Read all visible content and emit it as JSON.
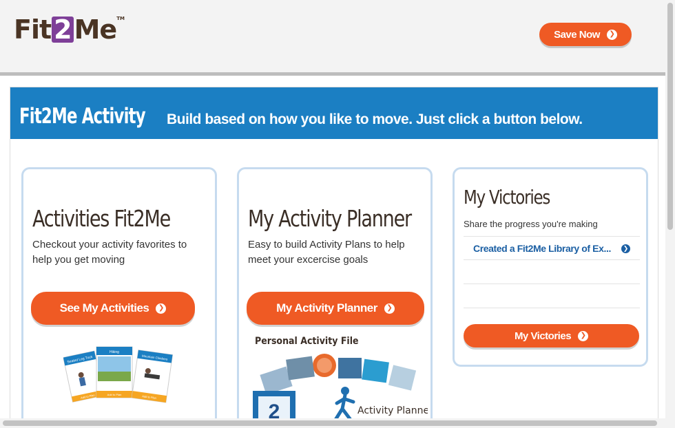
{
  "header": {
    "logo": {
      "part1": "Fit",
      "part2": "2",
      "part3": "Me",
      "tm": "TM"
    },
    "save_button": "Save Now"
  },
  "banner": {
    "title": "Fit2Me Activity",
    "subtitle": "Build based on how you like to move. Just click a button below."
  },
  "cards": [
    {
      "title": "Activities Fit2Me",
      "description": "Checkout your activity favorites to help you get moving",
      "button": "See My Activities",
      "illustration": {
        "cards": [
          {
            "title": "Seated Leg Tuck",
            "footer": "Add to Plan"
          },
          {
            "title": "Hiking",
            "footer": "Add to Plan"
          },
          {
            "title": "Mountain Climbers",
            "footer": "Add to Plan"
          }
        ]
      }
    },
    {
      "title": "My Activity Planner",
      "description": "Easy to build Activity Plans to help meet your excercise goals",
      "button": "My Activity Planner",
      "illustration": {
        "top_label": "Personal Activity File",
        "number": "2",
        "bottom_label": "Activity Planner"
      }
    },
    {
      "title": "My Victories",
      "description": "Share the progress you're making",
      "items": [
        "Created a Fit2Me Library of Ex...",
        "",
        ""
      ],
      "button": "My Victories"
    }
  ],
  "icons": {
    "button_arrow": "chevron-right-circle-icon",
    "link_arrow": "chevron-right-circle-icon"
  },
  "colors": {
    "accent_orange": "#ef5a24",
    "banner_blue": "#1b7fc3",
    "card_border": "#c6dbef",
    "logo_brown": "#4a3424",
    "logo_purple": "#7e3f98",
    "link_blue": "#1b5fa3"
  }
}
